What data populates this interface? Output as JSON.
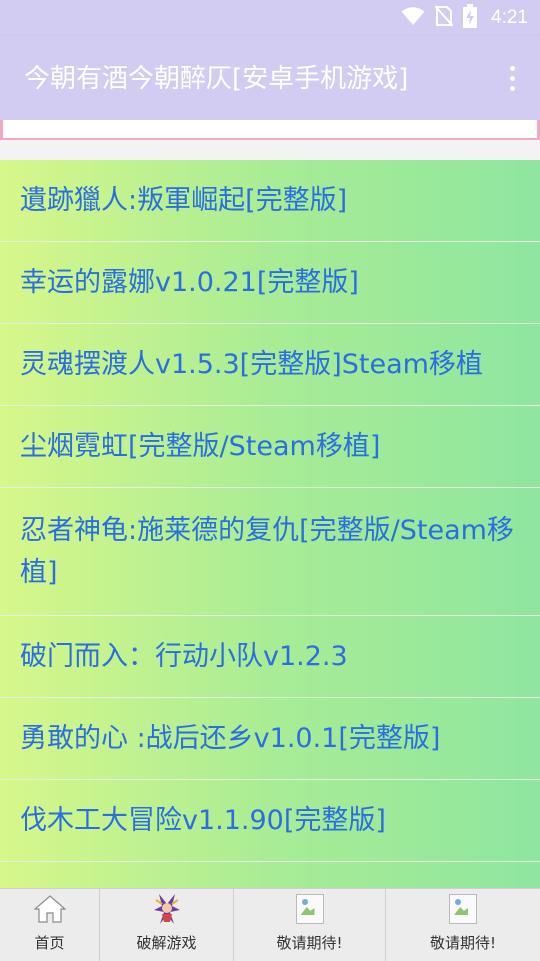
{
  "status_bar": {
    "time": "4:21",
    "icons": [
      "wifi-icon",
      "no-sim-icon",
      "battery-charging-icon"
    ]
  },
  "app_bar": {
    "title": "今朝有酒今朝醉仄[安卓手机游戏]",
    "menu_icon": "overflow-menu-icon"
  },
  "games": [
    "遺跡獵人:叛軍崛起[完整版]",
    "幸运的露娜v1.0.21[完整版]",
    "灵魂摆渡人v1.5.3[完整版]Steam移植",
    "尘烟霓虹[完整版/Steam移植]",
    "忍者神龟:施莱德的复仇[完整版/Steam移植]",
    "破门而入：行动小队v1.2.3",
    "勇敢的心 :战后还乡v1.0.1[完整版]",
    "伐木工大冒险v1.1.90[完整版]"
  ],
  "bottom_nav": {
    "items": [
      {
        "label": "首页",
        "icon": "home-icon"
      },
      {
        "label": "破解游戏",
        "icon": "game-character-icon"
      },
      {
        "label": "敬请期待!",
        "icon": "broken-image-icon"
      },
      {
        "label": "敬请期待!",
        "icon": "broken-image-icon"
      }
    ]
  },
  "colors": {
    "app_bar": "#d2ccf2",
    "list_text": "#2a6fe0",
    "list_gradient_start": "#d7f78a",
    "list_gradient_end": "#8fe6a0",
    "accent_border": "#f2a6c8"
  }
}
